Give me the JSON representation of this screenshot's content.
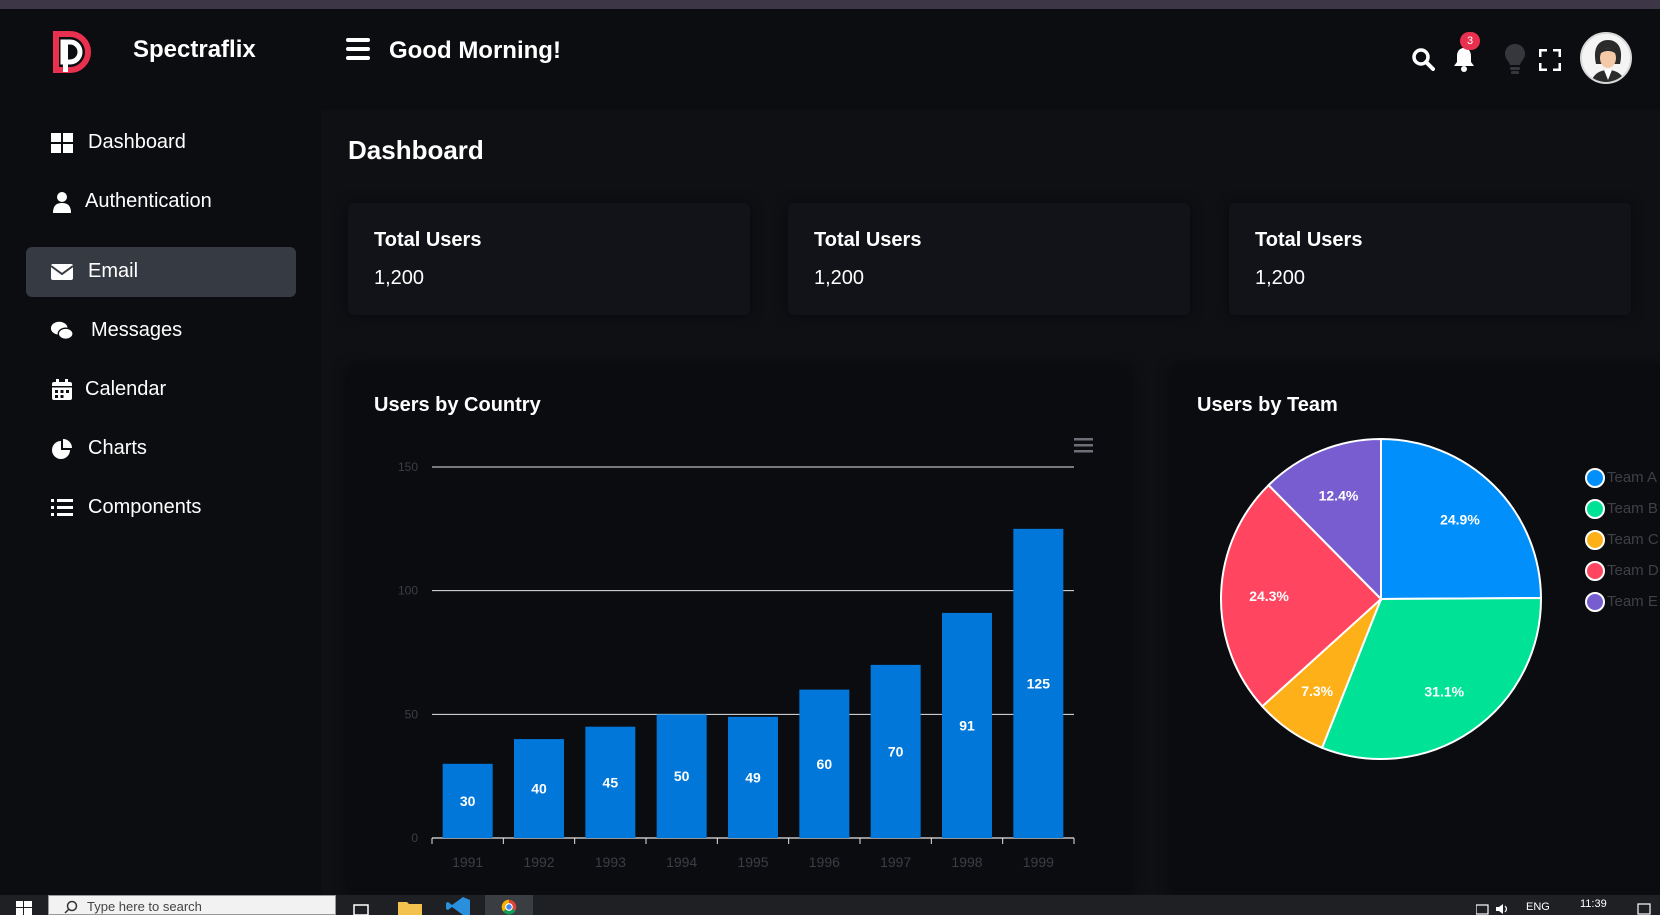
{
  "brand": {
    "name": "Spectraflix",
    "accent": "#e9304f"
  },
  "header": {
    "greeting": "Good Morning!",
    "notification_count": "3",
    "icons": [
      "menu-icon",
      "search-icon",
      "bell-icon",
      "lightbulb-icon",
      "fullscreen-icon",
      "avatar"
    ]
  },
  "sidebar": {
    "items": [
      {
        "label": "Dashboard",
        "icon": "dashboard-icon"
      },
      {
        "label": "Authentication",
        "icon": "user-icon"
      },
      {
        "label": "Email",
        "icon": "envelope-icon",
        "active": true
      },
      {
        "label": "Messages",
        "icon": "chat-bubbles-icon"
      },
      {
        "label": "Calendar",
        "icon": "calendar-icon"
      },
      {
        "label": "Charts",
        "icon": "pie-chart-icon"
      },
      {
        "label": "Components",
        "icon": "list-icon"
      }
    ]
  },
  "main": {
    "title": "Dashboard",
    "stats": [
      {
        "title": "Total Users",
        "value": "1,200"
      },
      {
        "title": "Total Users",
        "value": "1,200"
      },
      {
        "title": "Total Users",
        "value": "1,200"
      }
    ]
  },
  "panels": {
    "bar_title": "Users by Country",
    "pie_title": "Users by Team"
  },
  "chart_data": [
    {
      "type": "bar",
      "title": "Users by Country",
      "categories": [
        "1991",
        "1992",
        "1993",
        "1994",
        "1995",
        "1996",
        "1997",
        "1998",
        "1999"
      ],
      "values": [
        30,
        40,
        45,
        50,
        49,
        60,
        70,
        91,
        125
      ],
      "ylim": [
        0,
        150
      ],
      "yticks": [
        0,
        50,
        100,
        150
      ],
      "grid": true,
      "color": "#0077d9"
    },
    {
      "type": "pie",
      "title": "Users by Team",
      "labels": [
        "Team A",
        "Team B",
        "Team C",
        "Team D",
        "Team E"
      ],
      "values": [
        24.9,
        31.1,
        7.3,
        24.3,
        12.4
      ],
      "value_labels": [
        "24.9%",
        "31.1%",
        "7.3%",
        "24.3%",
        "12.4%"
      ],
      "colors": [
        "#008ffb",
        "#00e396",
        "#feb019",
        "#ff4560",
        "#775dd0"
      ],
      "legend": "right"
    }
  ],
  "taskbar": {
    "search_placeholder": "Type here to search",
    "language": "ENG",
    "time": "11:39"
  }
}
